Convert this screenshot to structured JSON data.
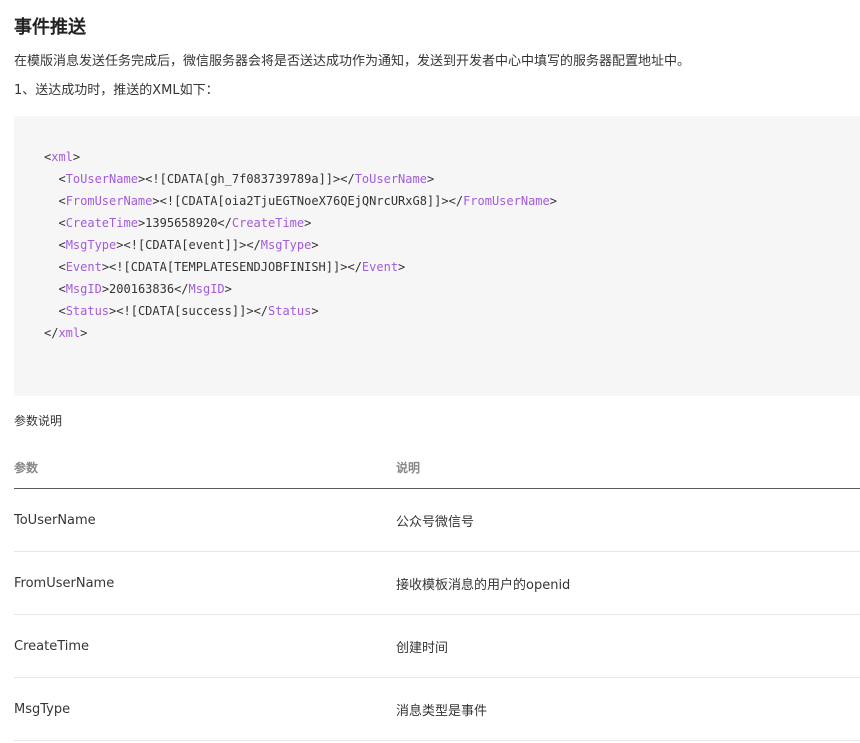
{
  "section": {
    "title": "事件推送",
    "intro": "在模版消息发送任务完成后，微信服务器会将是否送达成功作为通知，发送到开发者中心中填写的服务器配置地址中。",
    "subheading": "1、送达成功时，推送的XML如下："
  },
  "code_block": {
    "lines": [
      {
        "indent": "",
        "open_tag": "xml",
        "content": "",
        "close_tag": ""
      },
      {
        "indent": "  ",
        "open_tag": "ToUserName",
        "content": "<![CDATA[gh_7f083739789a]]>",
        "close_tag": "ToUserName"
      },
      {
        "indent": "  ",
        "open_tag": "FromUserName",
        "content": "<![CDATA[oia2TjuEGTNoeX76QEjQNrcURxG8]]>",
        "close_tag": "FromUserName"
      },
      {
        "indent": "  ",
        "open_tag": "CreateTime",
        "content": "1395658920",
        "close_tag": "CreateTime"
      },
      {
        "indent": "  ",
        "open_tag": "MsgType",
        "content": "<![CDATA[event]]>",
        "close_tag": "MsgType"
      },
      {
        "indent": "  ",
        "open_tag": "Event",
        "content": "<![CDATA[TEMPLATESENDJOBFINISH]]>",
        "close_tag": "Event"
      },
      {
        "indent": "  ",
        "open_tag": "MsgID",
        "content": "200163836",
        "close_tag": "MsgID"
      },
      {
        "indent": "  ",
        "open_tag": "Status",
        "content": "<![CDATA[success]]>",
        "close_tag": "Status"
      },
      {
        "indent": "",
        "open_tag": "",
        "content": "",
        "close_tag": "xml"
      }
    ]
  },
  "params_table": {
    "caption": "参数说明",
    "headers": {
      "param": "参数",
      "desc": "说明"
    },
    "rows": [
      {
        "param": "ToUserName",
        "desc": "公众号微信号"
      },
      {
        "param": "FromUserName",
        "desc": "接收模板消息的用户的openid"
      },
      {
        "param": "CreateTime",
        "desc": "创建时间"
      },
      {
        "param": "MsgType",
        "desc": "消息类型是事件"
      }
    ]
  },
  "colors": {
    "tag": "#a35bd8",
    "code_background": "#f6f6f6",
    "header_rule": "#5a5a5a",
    "row_rule": "#e7e7e7"
  }
}
